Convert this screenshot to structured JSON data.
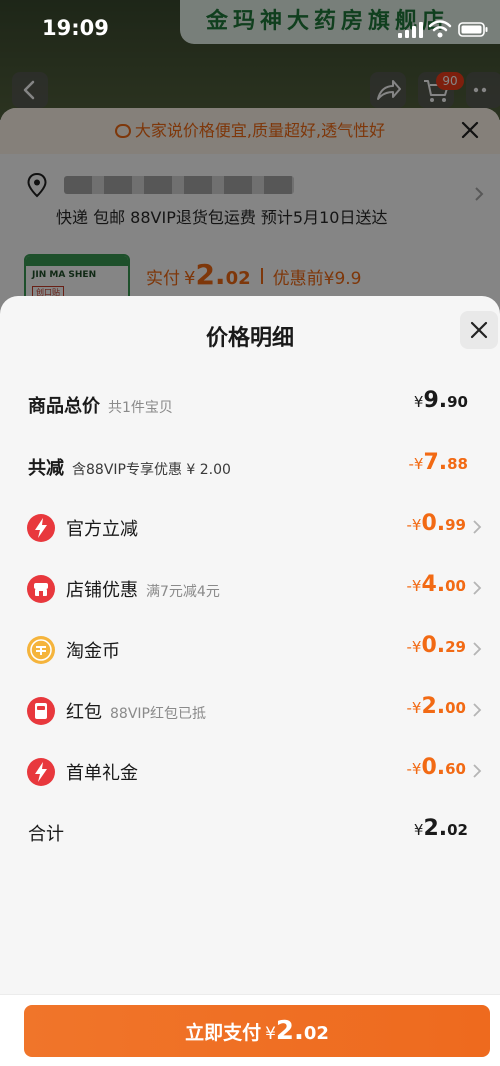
{
  "status_bar": {
    "time": "19:09"
  },
  "background": {
    "store_banner": "金玛神大药房旗舰店",
    "cart_badge": "90",
    "tip": "大家说价格便宜,质量超好,透气性好",
    "shipping": "快递 包邮 88VIP退货包运费 预计5月10日送达",
    "product_label": "JIN MA SHEN",
    "product_sub": "创口贴",
    "pay": {
      "label": "实付",
      "symbol": "¥",
      "int": "2.",
      "dec": "02",
      "before": "优惠前¥9.9"
    }
  },
  "modal": {
    "title": "价格明细",
    "rows": [
      {
        "label": "商品总价",
        "sub": "共1件宝贝",
        "symbol": "¥",
        "int": "9.",
        "dec": "90",
        "icon": ""
      },
      {
        "label": "共减",
        "sub": "含88VIP专享优惠 ¥ 2.00",
        "symbol": "-¥",
        "int": "7.",
        "dec": "88",
        "icon": ""
      },
      {
        "label": "官方立减",
        "sub": "",
        "symbol": "-¥",
        "int": "0.",
        "dec": "99",
        "icon": "lightning-icon"
      },
      {
        "label": "店铺优惠",
        "sub": "满7元减4元",
        "symbol": "-¥",
        "int": "4.",
        "dec": "00",
        "icon": "shop-icon"
      },
      {
        "label": "淘金币",
        "sub": "",
        "symbol": "-¥",
        "int": "0.",
        "dec": "29",
        "icon": "coin-icon"
      },
      {
        "label": "红包",
        "sub": "88VIP红包已抵",
        "symbol": "-¥",
        "int": "2.",
        "dec": "00",
        "icon": "red-packet-icon"
      },
      {
        "label": "首单礼金",
        "sub": "",
        "symbol": "-¥",
        "int": "0.",
        "dec": "60",
        "icon": "lightning-icon"
      },
      {
        "label": "合计",
        "sub": "",
        "symbol": "¥",
        "int": "2.",
        "dec": "02",
        "icon": ""
      }
    ]
  },
  "footer": {
    "button_label": "立即支付",
    "symbol": "¥",
    "int": "2.",
    "dec": "02"
  },
  "colors": {
    "accent": "#f26a14",
    "icon_red": "#e8383d",
    "coin_gold": "#f5b43c"
  }
}
